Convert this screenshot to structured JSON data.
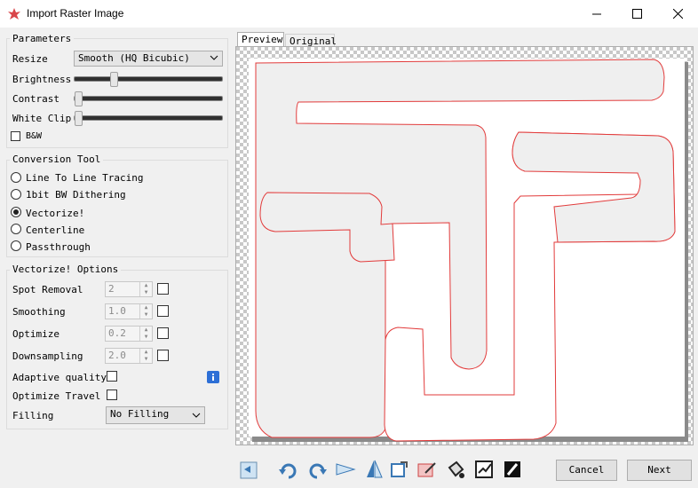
{
  "window": {
    "title": "Import Raster Image"
  },
  "parameters": {
    "title": "Parameters",
    "resize_label": "Resize",
    "resize_value": "Smooth (HQ Bicubic)",
    "brightness_label": "Brightness",
    "brightness_level": 0.25,
    "contrast_label": "Contrast",
    "contrast_level": 0.0,
    "whiteclip_label": "White Clip",
    "whiteclip_level": 0.0,
    "bw_label": "B&W",
    "bw_checked": false
  },
  "conversion": {
    "title": "Conversion Tool",
    "options": [
      {
        "label": "Line To Line Tracing",
        "selected": false
      },
      {
        "label": "1bit BW Dithering",
        "selected": false
      },
      {
        "label": "Vectorize!",
        "selected": true
      },
      {
        "label": "Centerline",
        "selected": false
      },
      {
        "label": "Passthrough",
        "selected": false
      }
    ]
  },
  "vectorize": {
    "title": "Vectorize! Options",
    "spot_removal_label": "Spot Removal",
    "spot_removal_value": "2",
    "smoothing_label": "Smoothing",
    "smoothing_value": "1.0",
    "optimize_label": "Optimize",
    "optimize_value": "0.2",
    "downsampling_label": "Downsampling",
    "downsampling_value": "2.0",
    "adaptive_label": "Adaptive quality",
    "optimize_travel_label": "Optimize Travel",
    "filling_label": "Filling",
    "filling_value": "No Filling"
  },
  "tabs": {
    "preview": "Preview",
    "original": "Original"
  },
  "buttons": {
    "cancel": "Cancel",
    "next": "Next"
  },
  "toolbar_icons": [
    "back-icon",
    "rotate-left-icon",
    "rotate-right-icon",
    "flip-horizontal-icon",
    "flip-vertical-icon",
    "crop-icon",
    "edit-icon",
    "color-fill-icon",
    "bucket-icon",
    "select-icon",
    "invert-icon"
  ],
  "colors": {
    "outline": "#e23b3b",
    "shape_fill": "#efefef",
    "info": "#2d6fd6"
  }
}
